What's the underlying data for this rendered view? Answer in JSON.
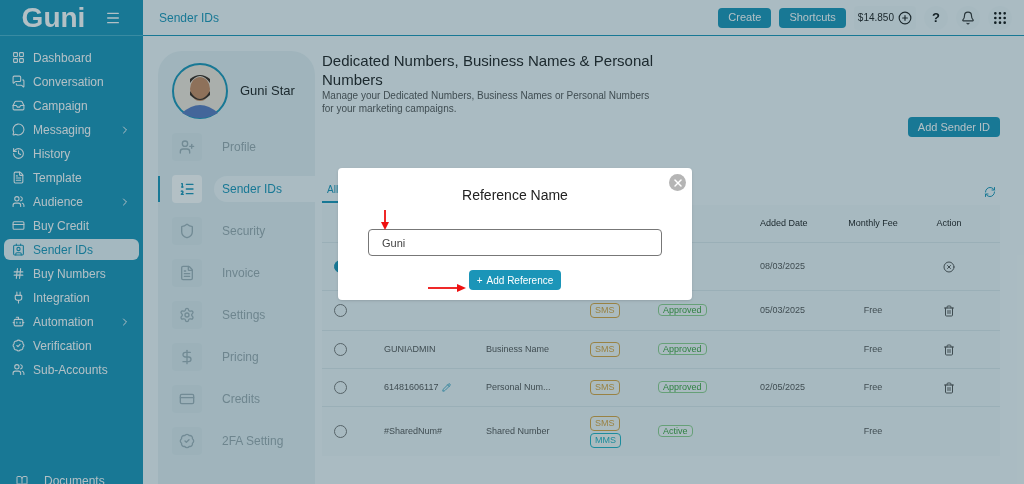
{
  "sidebar": {
    "logo": "Guni",
    "items": [
      {
        "label": "Dashboard",
        "submenu": false,
        "selected": false
      },
      {
        "label": "Conversation",
        "submenu": false,
        "selected": false
      },
      {
        "label": "Campaign",
        "submenu": false,
        "selected": false
      },
      {
        "label": "Messaging",
        "submenu": true,
        "selected": false
      },
      {
        "label": "History",
        "submenu": false,
        "selected": false
      },
      {
        "label": "Template",
        "submenu": false,
        "selected": false
      },
      {
        "label": "Audience",
        "submenu": true,
        "selected": false
      },
      {
        "label": "Buy Credit",
        "submenu": false,
        "selected": false
      },
      {
        "label": "Sender IDs",
        "submenu": false,
        "selected": true
      },
      {
        "label": "Buy Numbers",
        "submenu": false,
        "selected": false
      },
      {
        "label": "Integration",
        "submenu": false,
        "selected": false
      },
      {
        "label": "Automation",
        "submenu": true,
        "selected": false
      },
      {
        "label": "Verification",
        "submenu": false,
        "selected": false
      },
      {
        "label": "Sub-Accounts",
        "submenu": false,
        "selected": false
      }
    ],
    "footer": "Documents"
  },
  "topbar": {
    "page_title": "Sender IDs",
    "buttons": [
      "Create",
      "Shortcuts"
    ],
    "balance": "$14.850",
    "help": "?"
  },
  "profile": {
    "name": "Guni Star",
    "menu": [
      {
        "label": "Profile",
        "selected": false
      },
      {
        "label": "Sender IDs",
        "selected": true
      },
      {
        "label": "Security",
        "selected": false
      },
      {
        "label": "Invoice",
        "selected": false
      },
      {
        "label": "Settings",
        "selected": false
      },
      {
        "label": "Pricing",
        "selected": false
      },
      {
        "label": "Credits",
        "selected": false
      },
      {
        "label": "2FA Setting",
        "selected": false
      }
    ]
  },
  "header": {
    "title": "Dedicated Numbers, Business Names & Personal Numbers",
    "description": "Manage your Dedicated Numbers, Business Names or Personal Numbers for your marketing campaigns.",
    "add_button": "Add Sender ID"
  },
  "tabs": [
    {
      "label": "All",
      "selected": true
    }
  ],
  "table": {
    "columns": [
      "Added Date",
      "Monthly Fee",
      "Action"
    ],
    "rows": [
      {
        "kind": "cancelable",
        "selected": true,
        "sender_id": "",
        "type": "",
        "channels": [],
        "status": "",
        "editable": false,
        "added_date": "08/03/2025",
        "fee": ""
      },
      {
        "kind": "deletable",
        "selected": false,
        "sender_id": "",
        "type": "",
        "channels": [
          {
            "label": "SMS",
            "kind": "sms"
          }
        ],
        "status": "Approved",
        "editable": false,
        "added_date": "05/03/2025",
        "fee": "Free"
      },
      {
        "kind": "deletable",
        "selected": false,
        "sender_id": "GUNIADMIN",
        "type": "Business Name",
        "channels": [
          {
            "label": "SMS",
            "kind": "sms"
          }
        ],
        "status": "Approved",
        "editable": false,
        "added_date": "",
        "fee": "Free"
      },
      {
        "kind": "deletable",
        "selected": false,
        "sender_id": "61481606117",
        "type": "Personal Num...",
        "channels": [
          {
            "label": "SMS",
            "kind": "sms"
          }
        ],
        "status": "Approved",
        "editable": true,
        "added_date": "02/05/2025",
        "fee": "Free"
      },
      {
        "kind": "plain",
        "selected": false,
        "sender_id": "#SharedNum#",
        "type": "Shared Number",
        "channels": [
          {
            "label": "SMS",
            "kind": "sms"
          },
          {
            "label": "MMS",
            "kind": "mms"
          }
        ],
        "status": "Active",
        "editable": false,
        "added_date": "",
        "fee": "Free"
      }
    ]
  },
  "modal": {
    "title": "Reference Name",
    "value": "Guni",
    "button": "Add Reference",
    "button_icon": "+"
  }
}
